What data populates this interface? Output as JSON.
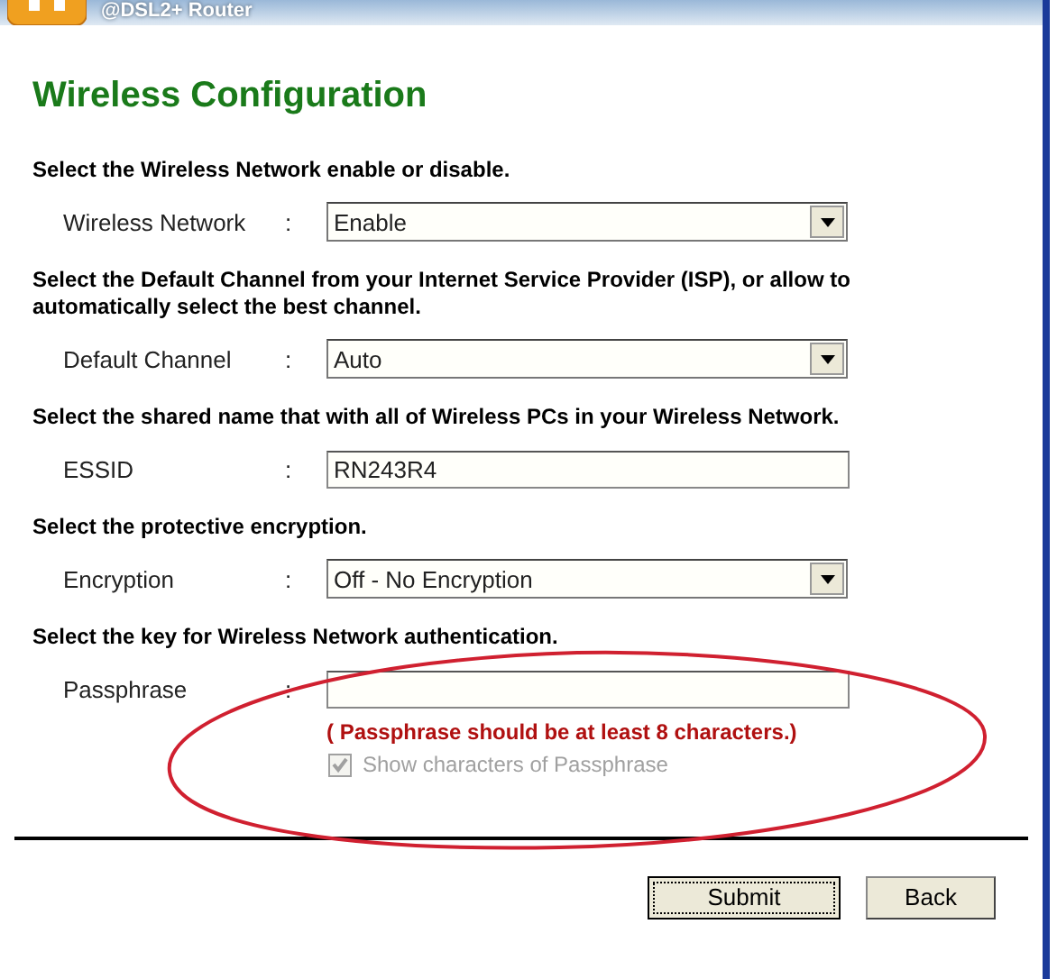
{
  "header": {
    "title": "@DSL2+ Router"
  },
  "page_title": "Wireless Configuration",
  "sections": [
    {
      "heading": "Select the Wireless Network enable or disable.",
      "fields": [
        {
          "label": "Wireless Network",
          "separator": ":",
          "kind": "select",
          "value": "Enable"
        }
      ]
    },
    {
      "heading": "Select the Default Channel from your Internet Service Provider (ISP),  or allow to automatically select the best channel.",
      "fields": [
        {
          "label": "Default Channel",
          "separator": ":",
          "kind": "select",
          "value": "Auto"
        }
      ]
    },
    {
      "heading": "Select the shared name that with all of Wireless PCs in your Wireless Network.",
      "fields": [
        {
          "label": "ESSID",
          "separator": ":",
          "kind": "text",
          "value": "RN243R4"
        }
      ]
    },
    {
      "heading": "Select the protective encryption.",
      "fields": [
        {
          "label": "Encryption",
          "separator": ":",
          "kind": "select",
          "value": "Off - No Encryption"
        }
      ]
    },
    {
      "heading": "Select the key for Wireless Network authentication.",
      "fields": [
        {
          "label": "Passphrase",
          "separator": ":",
          "kind": "text"
        }
      ],
      "error": "( Passphrase should be at least 8 characters.)",
      "checkbox": {
        "label": "Show characters of Passphrase",
        "checked": true,
        "disabled": true
      }
    }
  ],
  "buttons": [
    {
      "label": "Submit",
      "focused": true
    },
    {
      "label": "Back",
      "focused": false
    }
  ]
}
